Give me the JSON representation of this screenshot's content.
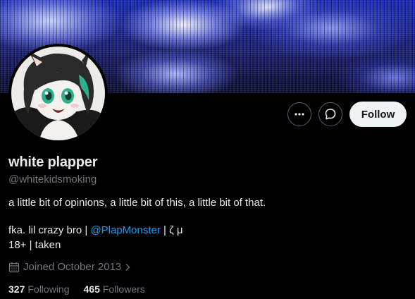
{
  "profile": {
    "display_name": "white plapper",
    "handle": "@whitekidsmoking",
    "bio_line1": "a little bit of opinions, a little bit of this, a little bit of that.",
    "bio_line2_prefix": "fka. lil crazy bro | ",
    "bio_line2_mention": "@PlapMonster",
    "bio_line2_suffix": " | ζ μ",
    "bio_line3": "18+ | taken",
    "joined": "Joined October 2013"
  },
  "actions": {
    "more_icon": "more-horizontal-icon",
    "message_icon": "message-bubble-icon",
    "follow_label": "Follow"
  },
  "stats": {
    "following_count": "327",
    "following_label": "Following",
    "followers_count": "465",
    "followers_label": "Followers"
  },
  "colors": {
    "background": "#000000",
    "text_primary": "#e7e9ea",
    "text_secondary": "#71767b",
    "link": "#1d9bf0",
    "follow_button_bg": "#eff3f4"
  }
}
